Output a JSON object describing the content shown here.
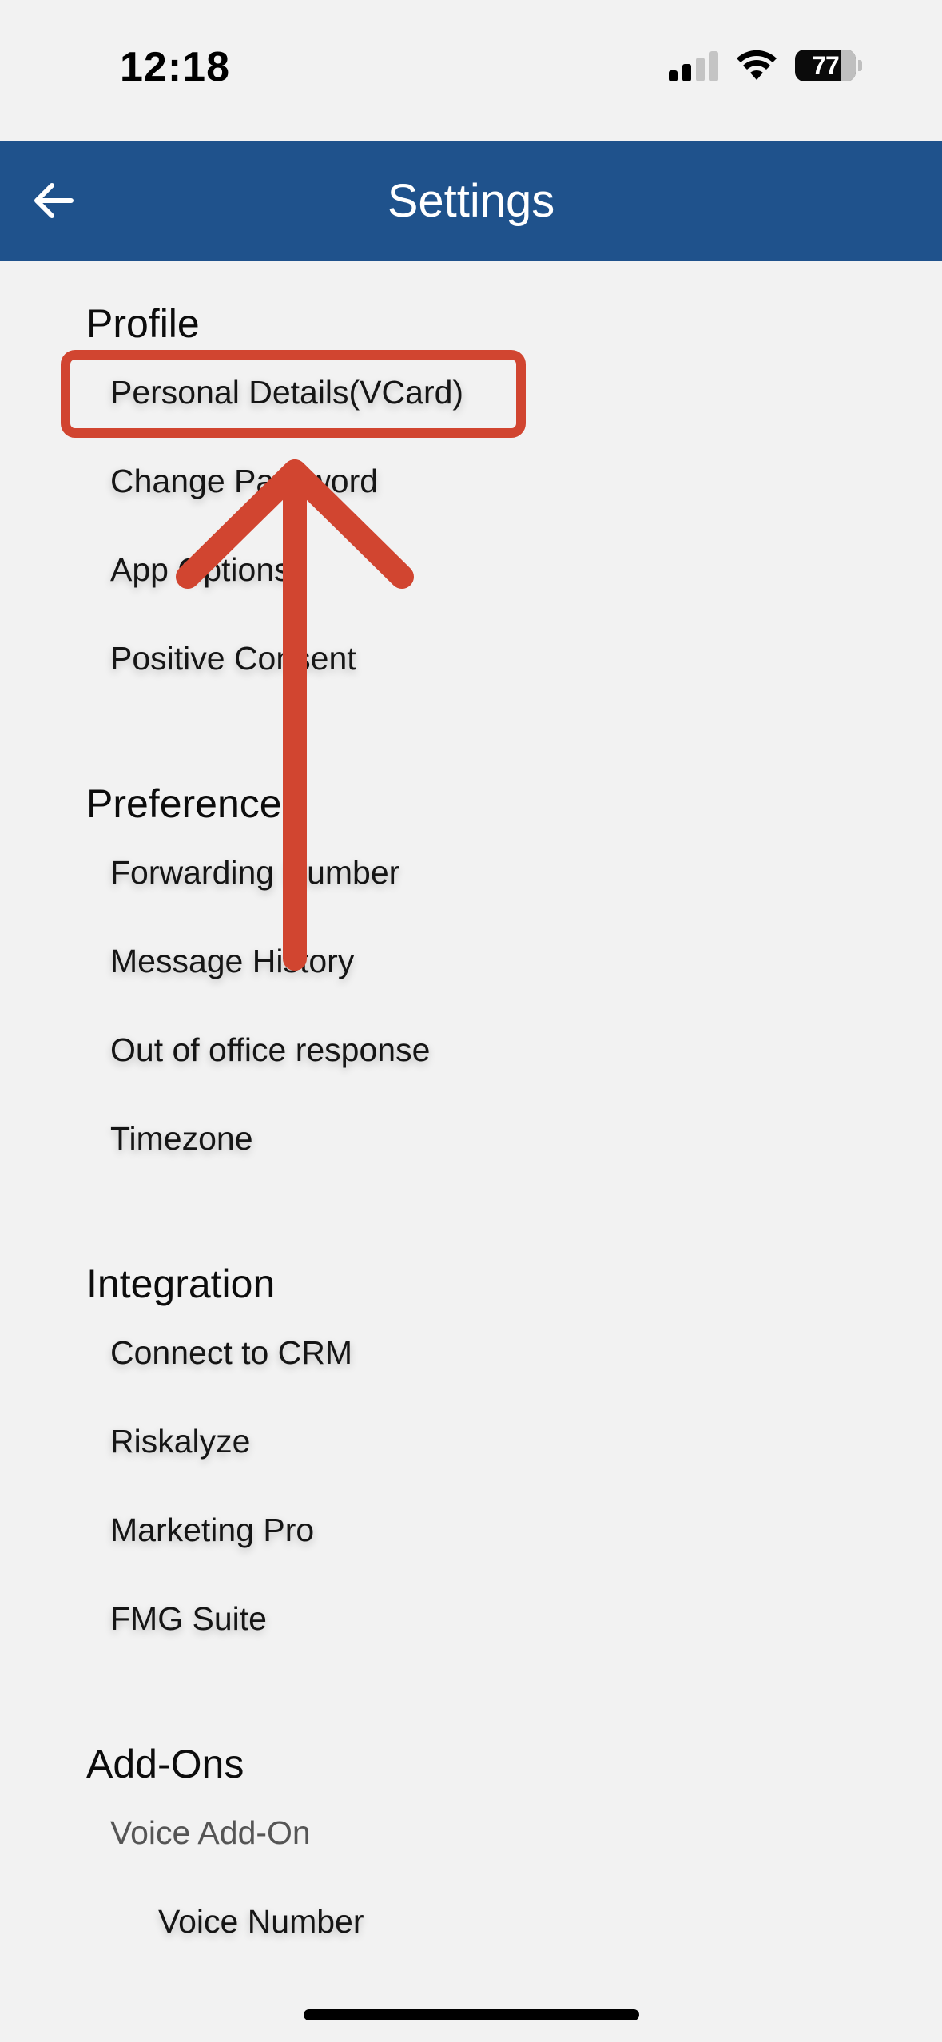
{
  "status_bar": {
    "time": "12:18",
    "battery_level": "77",
    "icons": [
      "cellular-signal-icon",
      "wifi-icon",
      "battery-icon"
    ]
  },
  "header": {
    "title": "Settings",
    "back_icon": "arrow-left-icon",
    "background_color": "#1f528c"
  },
  "sections": {
    "profile": {
      "title": "Profile",
      "items": [
        "Personal Details(VCard)",
        "Change Password",
        "App Options",
        "Positive Consent"
      ]
    },
    "preference": {
      "title": "Preference",
      "items": [
        "Forwarding Number",
        "Message History",
        "Out of office response",
        "Timezone"
      ]
    },
    "integration": {
      "title": "Integration",
      "items": [
        "Connect to CRM",
        "Riskalyze",
        "Marketing Pro",
        "FMG Suite"
      ]
    },
    "addons": {
      "title": "Add-Ons",
      "items": [
        "Voice Add-On",
        "Voice Number"
      ]
    }
  },
  "annotation": {
    "color": "#d14530",
    "highlighted_item": "Personal Details(VCard)"
  }
}
